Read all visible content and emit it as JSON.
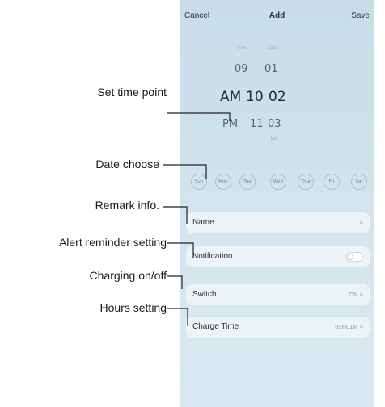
{
  "nav": {
    "cancel": "Cancel",
    "title": "Add",
    "save": "Save"
  },
  "picker": {
    "faint_top": [
      "CXX",
      "CCC"
    ],
    "hour_above": "09",
    "minute_above": "01",
    "ampm_selected": "AM",
    "hour_selected": "10",
    "minute_selected": "02",
    "ampm_below": "PM",
    "hour_below": "11",
    "minute_below": "03",
    "faint_bottom": "Lxx"
  },
  "days": [
    "Sun",
    "Mon",
    "Tue",
    "Wed",
    "Thur",
    "Fri",
    "Sat"
  ],
  "rows": {
    "name": {
      "label": "Name",
      "value": ">"
    },
    "notification": {
      "label": "Notification",
      "on": false
    },
    "switch": {
      "label": "Switch",
      "value": "ON >"
    },
    "charge_time": {
      "label": "Charge Time",
      "value": "00H01M >"
    }
  },
  "callouts": {
    "set_time_point": "Set time point",
    "date_choose": "Date choose",
    "remark_info": "Remark info.",
    "alert_reminder": "Alert reminder setting",
    "charging_onoff": "Charging on/off",
    "hours_setting": "Hours setting"
  }
}
